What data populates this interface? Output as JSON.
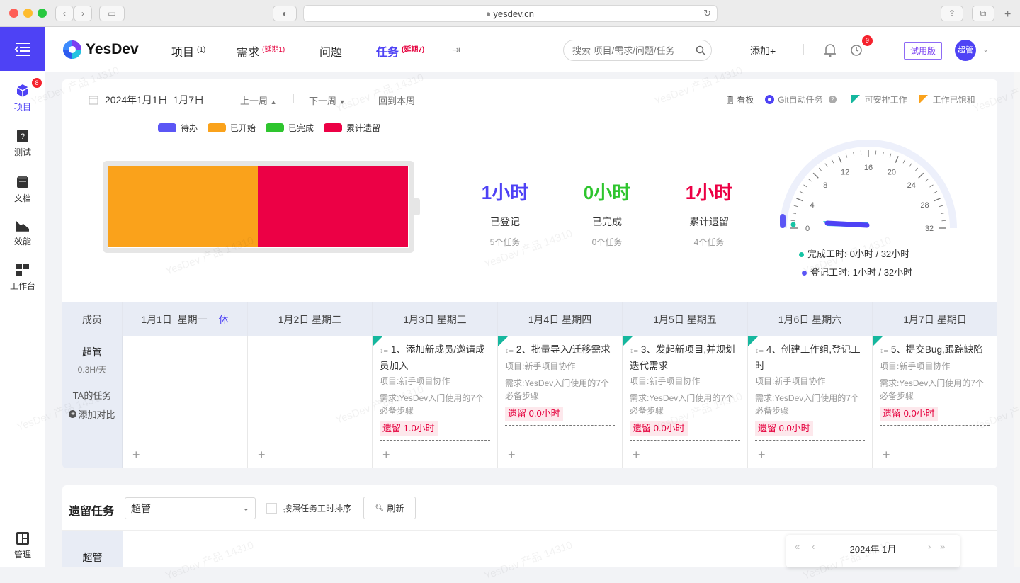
{
  "browser": {
    "url": "yesdev.cn"
  },
  "sidebar": {
    "badge": "8",
    "items": [
      {
        "label": "项目"
      },
      {
        "label": "测试"
      },
      {
        "label": "文档"
      },
      {
        "label": "效能"
      },
      {
        "label": "工作台"
      },
      {
        "label": "管理"
      }
    ]
  },
  "header": {
    "logo": "YesDev",
    "tabs": [
      {
        "label": "项目",
        "sup": "(1)"
      },
      {
        "label": "需求",
        "sup": "(延期1)"
      },
      {
        "label": "问题",
        "sup": ""
      },
      {
        "label": "任务",
        "sup": "(延期7)"
      }
    ],
    "search_placeholder": "搜索 项目/需求/问题/任务",
    "add_label": "添加+",
    "alarm_badge": "9",
    "trial_label": "试用版",
    "avatar": "超管",
    "accent": "#4e42f5"
  },
  "toolbar": {
    "date_range": "2024年1月1日–1月7日",
    "prev_week": "上一周",
    "next_week": "下一周",
    "back_this_week": "回到本周",
    "kanban": "看板",
    "git_auto": "Git自动任务",
    "schedulable": "可安排工作",
    "saturated": "工作已饱和"
  },
  "legend": [
    {
      "label": "待办",
      "color": "#5b56f5"
    },
    {
      "label": "已开始",
      "color": "#faa21b"
    },
    {
      "label": "已完成",
      "color": "#2ec52e"
    },
    {
      "label": "累计遗留",
      "color": "#ec0045"
    }
  ],
  "battery": {
    "started_fraction": 0.5,
    "left_fraction": 0.5
  },
  "stats": [
    {
      "value": "1小时",
      "label": "已登记",
      "sub": "5个任务",
      "color": "#4e42f5"
    },
    {
      "value": "0小时",
      "label": "已完成",
      "sub": "0个任务",
      "color": "#2ec52e"
    },
    {
      "value": "1小时",
      "label": "累计遗留",
      "sub": "4个任务",
      "color": "#ec0045"
    }
  ],
  "gauge": {
    "ticks": [
      "0",
      "4",
      "8",
      "12",
      "16",
      "20",
      "24",
      "28",
      "32"
    ],
    "completed_label": "完成工时:",
    "completed_value": "0小时 / 32小时",
    "logged_label": "登记工时:",
    "logged_value": "1小时 / 32小时",
    "logged_hours": 1,
    "max_hours": 32
  },
  "grid": {
    "member_header": "成员",
    "rest_label": "休",
    "days": [
      "1月1日  星期一",
      "1月2日  星期二",
      "1月3日  星期三",
      "1月4日  星期四",
      "1月5日  星期五",
      "1月6日  星期六",
      "1月7日  星期日"
    ],
    "member": {
      "name": "超管",
      "rate": "0.3H/天",
      "ta_tasks": "TA的任务",
      "add_compare": "添加对比"
    },
    "tasks": [
      null,
      null,
      {
        "title": "1、添加新成员/邀请成员加入",
        "project": "项目:新手项目协作",
        "req": "需求:YesDev入门使用的7个必备步骤",
        "left": "遗留 1.0小时"
      },
      {
        "title": "2、批量导入/迁移需求",
        "project": "项目:新手项目协作",
        "req": "需求:YesDev入门使用的7个必备步骤",
        "left": "遗留 0.0小时"
      },
      {
        "title": "3、发起新项目,并规划迭代需求",
        "project": "项目:新手项目协作",
        "req": "需求:YesDev入门使用的7个必备步骤",
        "left": "遗留 0.0小时"
      },
      {
        "title": "4、创建工作组,登记工时",
        "project": "项目:新手项目协作",
        "req": "需求:YesDev入门使用的7个必备步骤",
        "left": "遗留 0.0小时"
      },
      {
        "title": "5、提交Bug,跟踪缺陷",
        "project": "项目:新手项目协作",
        "req": "需求:YesDev入门使用的7个必备步骤",
        "left": "遗留 0.0小时"
      }
    ]
  },
  "leftover": {
    "title": "遗留任务",
    "select_value": "超管",
    "sort_label": "按照任务工时排序",
    "refresh": "刷新",
    "row_member": "超管",
    "calendar": "2024年 1月"
  },
  "watermark": "YesDev 产品 14310"
}
